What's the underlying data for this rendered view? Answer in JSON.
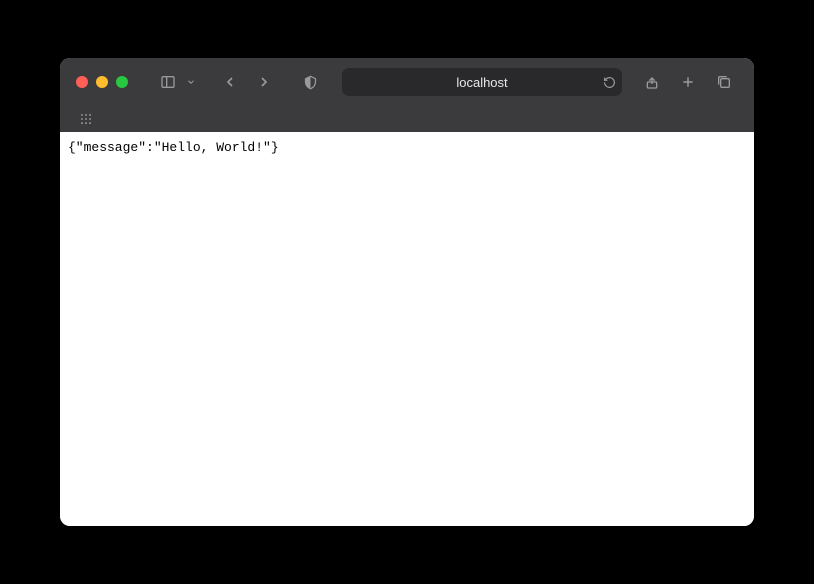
{
  "address_bar": {
    "url_text": "localhost"
  },
  "page": {
    "body_text": "{\"message\":\"Hello, World!\"}"
  }
}
